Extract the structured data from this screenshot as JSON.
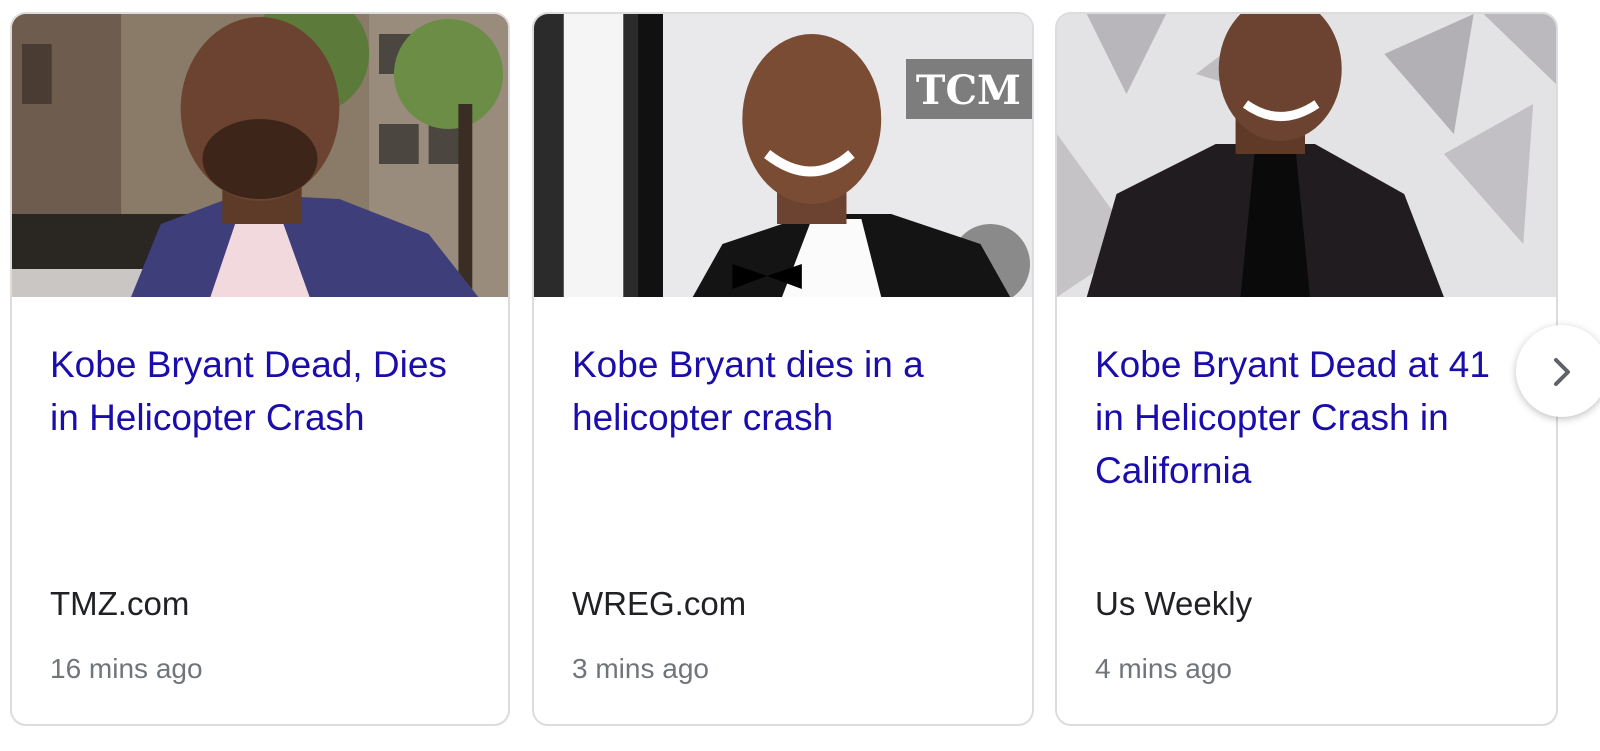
{
  "cards": [
    {
      "headline": "Kobe Bryant Dead, Dies in Helicopter Crash",
      "source": "TMZ.com",
      "time": "16 mins ago"
    },
    {
      "headline": "Kobe Bryant dies in a helicopter crash",
      "source": "WREG.com",
      "time": "3 mins ago"
    },
    {
      "headline": "Kobe Bryant Dead at 41 in Helicopter Crash in California",
      "source": "Us Weekly",
      "time": "4 mins ago"
    }
  ],
  "thumb2_logo": "TCM",
  "colors": {
    "headline": "#1a0dab",
    "source": "#202124",
    "time": "#70757a",
    "card_border": "#dcdcdc"
  },
  "icons": {
    "next": "chevron-right-icon"
  }
}
